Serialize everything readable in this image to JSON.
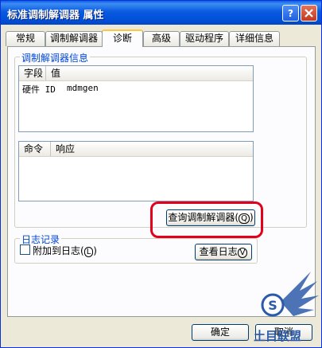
{
  "window": {
    "title": "标准调制解调器 属性"
  },
  "tabs": [
    {
      "label": "常规"
    },
    {
      "label": "调制解调器"
    },
    {
      "label": "诊断"
    },
    {
      "label": "高级"
    },
    {
      "label": "驱动程序"
    },
    {
      "label": "详细信息"
    }
  ],
  "modem_info": {
    "group_label": "调制解调器信息",
    "columns": [
      "字段",
      "值"
    ],
    "rows": [
      {
        "field": "硬件 ID",
        "value": "mdmgen"
      }
    ]
  },
  "command_list": {
    "columns": [
      "命令",
      "响应"
    ]
  },
  "query_button": {
    "label": "查询调制解调器",
    "hotkey": "Q"
  },
  "log": {
    "group_label": "日志记录",
    "append_label": "附加到日志",
    "append_hotkey": "L",
    "view_label": "查看日志",
    "view_hotkey": "V"
  },
  "footer": {
    "ok_label": "确定",
    "cancel_label": "取消"
  },
  "watermark": {
    "text": "土目联盟"
  },
  "colors": {
    "title_bar": "#0a5ae0",
    "highlight_ring": "#e3001b",
    "group_label": "#0046d5"
  }
}
